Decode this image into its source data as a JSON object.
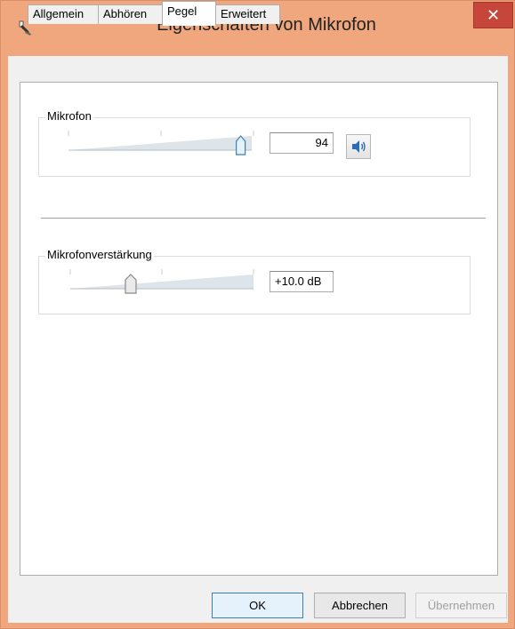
{
  "window": {
    "title": "Eigenschaften von Mikrofon",
    "close_glyph": "✕",
    "icon": "microphone-icon"
  },
  "tabs": [
    {
      "label": "Allgemein",
      "active": false
    },
    {
      "label": "Abhören",
      "active": false
    },
    {
      "label": "Pegel",
      "active": true
    },
    {
      "label": "Erweitert",
      "active": false
    }
  ],
  "mikrofon": {
    "label": "Mikrofon",
    "value": "94",
    "level_fraction": 0.94,
    "mute_icon": "speaker-icon"
  },
  "boost": {
    "label": "Mikrofonverstärkung",
    "value": "+10.0 dB",
    "level_fraction": 0.33
  },
  "buttons": {
    "ok": "OK",
    "cancel": "Abbrechen",
    "apply": "Übernehmen"
  },
  "colors": {
    "titlebar": "#f0a77e",
    "close": "#c7463c",
    "slider_thumb": "#3c7fb1"
  }
}
